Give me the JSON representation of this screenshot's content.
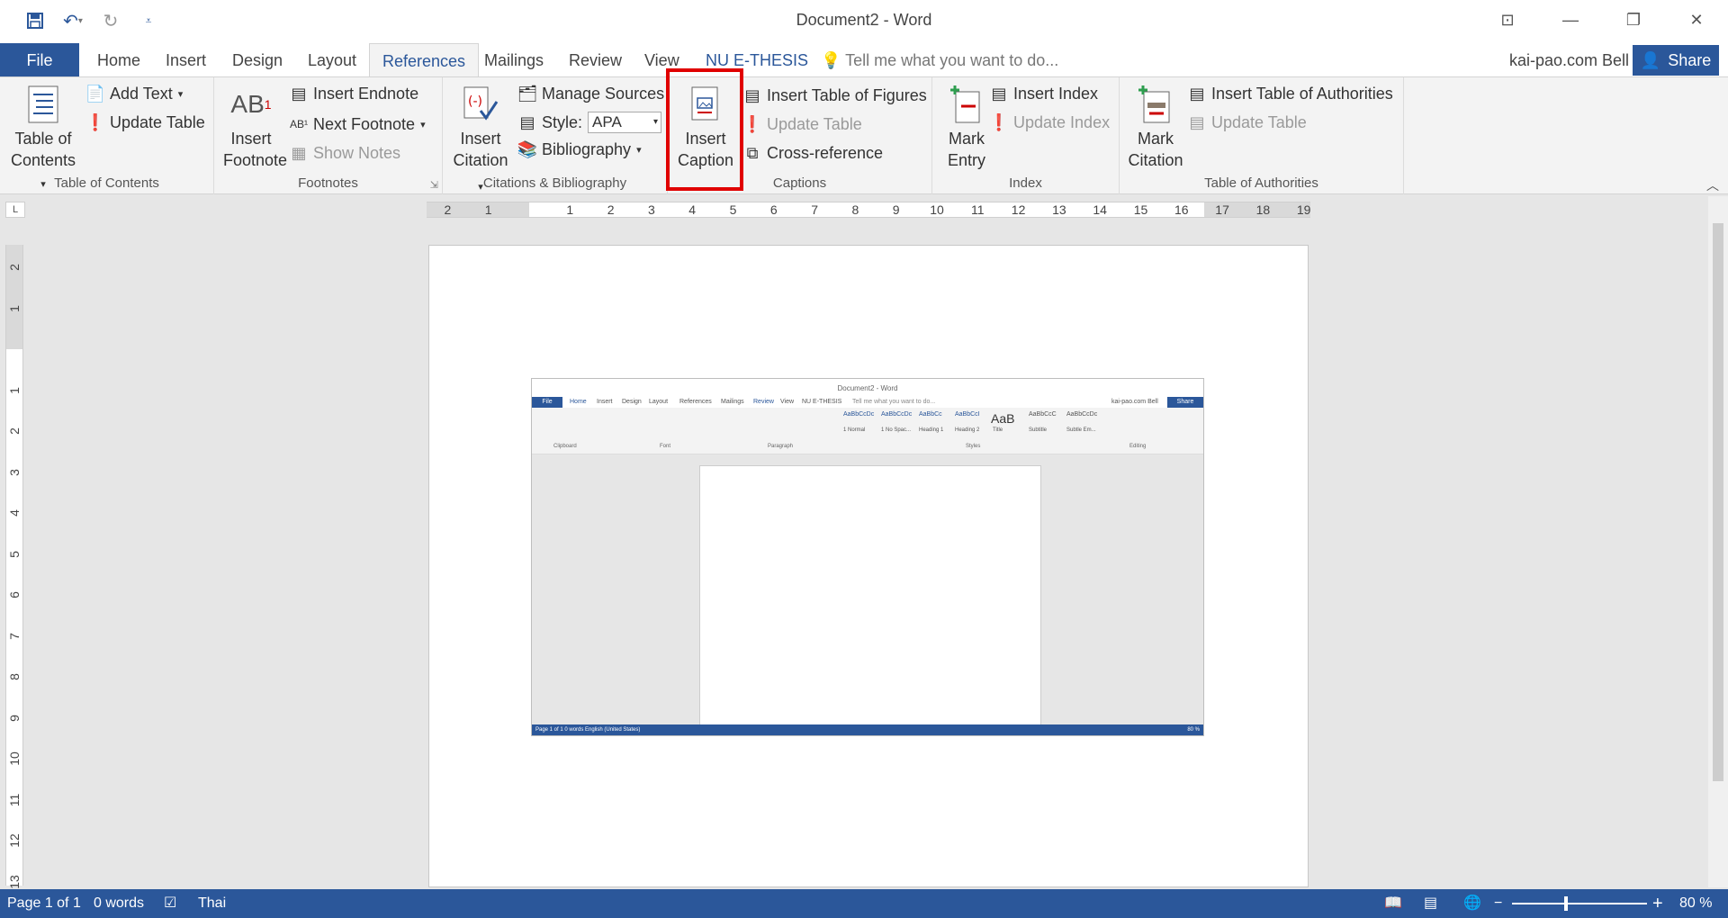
{
  "window": {
    "title": "Document2 - Word",
    "account": "kai-pao.com Bell",
    "share_label": "Share"
  },
  "qat": {
    "save": "save-icon",
    "undo": "undo-icon",
    "redo": "redo-icon",
    "customize": "customize-icon"
  },
  "tabs": [
    {
      "label": "File"
    },
    {
      "label": "Home"
    },
    {
      "label": "Insert"
    },
    {
      "label": "Design"
    },
    {
      "label": "Layout"
    },
    {
      "label": "References"
    },
    {
      "label": "Mailings"
    },
    {
      "label": "Review"
    },
    {
      "label": "View"
    },
    {
      "label": "NU E-THESIS"
    }
  ],
  "tellme": "Tell me what you want to do...",
  "ribbon": {
    "toc": {
      "table_of_contents_1": "Table of",
      "table_of_contents_2": "Contents",
      "add_text": "Add Text",
      "update_table": "Update Table",
      "label": "Table of Contents"
    },
    "footnotes": {
      "insert_footnote_1": "Insert",
      "insert_footnote_2": "Footnote",
      "insert_endnote": "Insert Endnote",
      "next_footnote": "Next Footnote",
      "show_notes": "Show Notes",
      "label": "Footnotes"
    },
    "citations": {
      "insert_citation_1": "Insert",
      "insert_citation_2": "Citation",
      "manage_sources": "Manage Sources",
      "style_label": "Style:",
      "style_value": "APA",
      "bibliography": "Bibliography",
      "label": "Citations & Bibliography"
    },
    "captions": {
      "insert_caption_1": "Insert",
      "insert_caption_2": "Caption",
      "insert_table_of_figures": "Insert Table of Figures",
      "update_table": "Update Table",
      "cross_reference": "Cross-reference",
      "label": "Captions"
    },
    "index": {
      "mark_entry_1": "Mark",
      "mark_entry_2": "Entry",
      "insert_index": "Insert Index",
      "update_index": "Update Index",
      "label": "Index"
    },
    "authorities": {
      "mark_citation_1": "Mark",
      "mark_citation_2": "Citation",
      "insert_toa": "Insert Table of Authorities",
      "update_table": "Update Table",
      "label": "Table of Authorities"
    }
  },
  "ruler": {
    "h_ticks": [
      "2",
      "1",
      "",
      "1",
      "2",
      "3",
      "4",
      "5",
      "6",
      "7",
      "8",
      "9",
      "10",
      "11",
      "12",
      "13",
      "14",
      "15",
      "16",
      "17",
      "18",
      "19"
    ],
    "v_ticks": [
      "2",
      "1",
      "",
      "1",
      "2",
      "3",
      "4",
      "5",
      "6",
      "7",
      "8",
      "9",
      "10",
      "11",
      "12",
      "13"
    ]
  },
  "mini": {
    "title": "Document2 - Word",
    "tabs": [
      "File",
      "Home",
      "Insert",
      "Design",
      "Layout",
      "References",
      "Mailings",
      "Review",
      "View",
      "NU E-THESIS"
    ],
    "tellme": "Tell me what you want to do...",
    "account": "kai-pao.com Bell",
    "share": "Share",
    "styles": [
      "AaBbCcDc",
      "AaBbCcDc",
      "AaBbCc",
      "AaBbCcI",
      "AaB",
      "AaBbCcC",
      "AaBbCcDc"
    ],
    "style_names": [
      "1 Normal",
      "1 No Spac...",
      "Heading 1",
      "Heading 2",
      "Title",
      "Subtitle",
      "Subtle Em..."
    ],
    "group_labels": [
      "Clipboard",
      "Font",
      "Paragraph",
      "Styles",
      "Editing"
    ],
    "status": "Page 1 of 1    0 words    English (United States)",
    "zoom": "80 %"
  },
  "status": {
    "page": "Page 1 of 1",
    "words": "0 words",
    "language": "Thai",
    "zoom": "80 %"
  }
}
